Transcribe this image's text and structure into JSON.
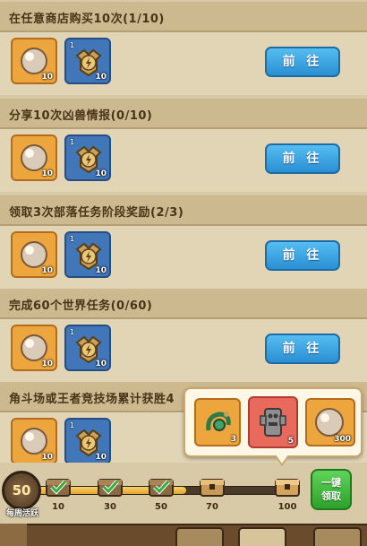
{
  "tasks": [
    {
      "title": "在任意商店购买10次(1/10)",
      "go_label": "前 往",
      "rewards": [
        {
          "icon": "pearl-orb-icon",
          "count": "10"
        },
        {
          "icon": "lightning-medal-icon",
          "count": "10"
        }
      ]
    },
    {
      "title": "分享10次凶兽情报(0/10)",
      "go_label": "前 往",
      "rewards": [
        {
          "icon": "pearl-orb-icon",
          "count": "10"
        },
        {
          "icon": "lightning-medal-icon",
          "count": "10"
        }
      ]
    },
    {
      "title": "领取3次部落任务阶段奖励(2/3)",
      "go_label": "前 往",
      "rewards": [
        {
          "icon": "pearl-orb-icon",
          "count": "10"
        },
        {
          "icon": "lightning-medal-icon",
          "count": "10"
        }
      ]
    },
    {
      "title": "完成60个世界任务(0/60)",
      "go_label": "前 往",
      "rewards": [
        {
          "icon": "pearl-orb-icon",
          "count": "10"
        },
        {
          "icon": "lightning-medal-icon",
          "count": "10"
        }
      ]
    },
    {
      "title": "角斗场或王者竞技场累计获胜4",
      "rewards": [
        {
          "icon": "pearl-orb-icon",
          "count": "10"
        },
        {
          "icon": "lightning-medal-icon",
          "count": "10"
        }
      ]
    }
  ],
  "popup": {
    "rewards": [
      {
        "icon": "green-scroll-icon",
        "count": "3"
      },
      {
        "icon": "stone-totem-icon",
        "count": "5"
      },
      {
        "icon": "pearl-orb-icon",
        "count": "300"
      }
    ]
  },
  "progress": {
    "activity_value": "50",
    "activity_label": "每周活跃",
    "fill_fraction": 0.6,
    "milestones": [
      {
        "value": "10",
        "claimed": true
      },
      {
        "value": "30",
        "claimed": true
      },
      {
        "value": "50",
        "claimed": true
      },
      {
        "value": "70",
        "claimed": false
      },
      {
        "value": "100",
        "claimed": false
      }
    ],
    "claim_label_1": "一键",
    "claim_label_2": "领取"
  },
  "colors": {
    "go_button": "#2b8fd3",
    "claim_button": "#2ea12c",
    "header": "#cdb98f"
  }
}
